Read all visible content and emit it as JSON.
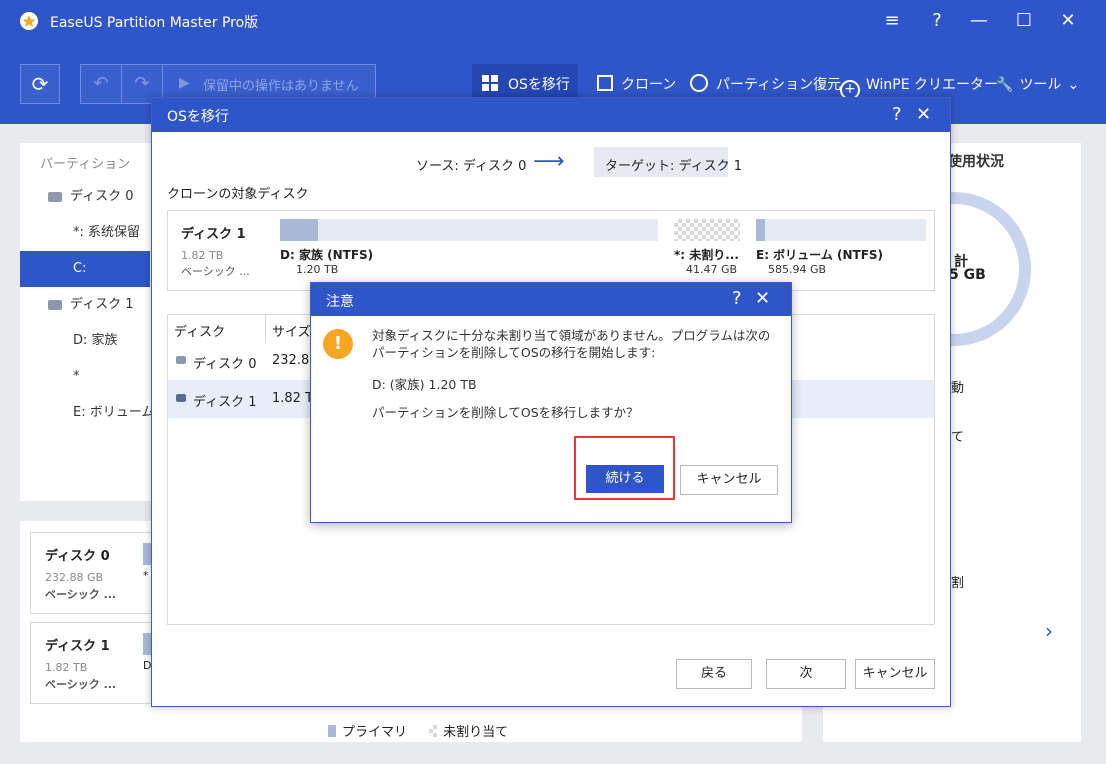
{
  "app": {
    "title": "EaseUS Partition Master Pro版"
  },
  "toolbar": {
    "pending": "保留中の操作はありません",
    "migrate_os": "OSを移行",
    "clone": "クローン",
    "recovery": "パーティション復元",
    "winpe": "WinPE クリエーター",
    "tools": "ツール"
  },
  "left_nav": {
    "header": "パーティション",
    "items": [
      {
        "label": "ディスク 0",
        "type": "disk"
      },
      {
        "label": "*: 系统保留",
        "type": "part"
      },
      {
        "label": "C:",
        "type": "part",
        "selected": true
      },
      {
        "label": "ディスク 1",
        "type": "disk"
      },
      {
        "label": "D: 家族",
        "type": "part"
      },
      {
        "label": "*",
        "type": "part"
      },
      {
        "label": "E: ボリューム",
        "type": "part"
      }
    ]
  },
  "bottom_disks": [
    {
      "name": "ディスク 0",
      "size": "232.88 GB",
      "kind": "ベーシック ...",
      "next_letter": "*"
    },
    {
      "name": "ディスク 1",
      "size": "1.82 TB",
      "kind": "ベーシック ...",
      "next_letter": "D"
    }
  ],
  "legend": {
    "primary": "プライマリ",
    "unallocated": "未割り当て"
  },
  "right_panel": {
    "header": "使用状況",
    "total_frag_1": "計",
    "total_frag_2": "5 GB",
    "op_1": "動",
    "op_2": "て",
    "op_3": "割"
  },
  "migrate_dialog": {
    "title": "OSを移行",
    "source": "ソース: ディスク 0",
    "arrow": "⟶",
    "target": "ターゲット: ディスク 1",
    "section_label": "クローンの対象ディスク",
    "disk": {
      "name": "ディスク 1",
      "size": "1.82 TB",
      "kind": "ベーシック ..."
    },
    "partitions": [
      {
        "name": "D: 家族 (NTFS)",
        "size": "1.20 TB",
        "used_fraction": 0.1
      },
      {
        "name": "*: 未割り...",
        "size": "41.47 GB",
        "used_fraction": 0
      },
      {
        "name": "E: ボリューム (NTFS)",
        "size": "585.94 GB",
        "used_fraction": 0.05
      }
    ],
    "table": {
      "columns": [
        "ディスク",
        "サイズ"
      ],
      "rows": [
        {
          "disk": "ディスク 0",
          "size": "232.88"
        },
        {
          "disk": "ディスク 1",
          "size": "1.82 TB"
        }
      ]
    },
    "buttons": {
      "back": "戻る",
      "next": "次",
      "cancel": "キャンセル"
    }
  },
  "warning": {
    "title": "注意",
    "message": "対象ディスクに十分な未割り当て領域がありません。プログラムは次のパーティションを削除してOSの移行を開始します:",
    "partition": "D: (家族) 1.20 TB",
    "question": "パーティションを削除してOSを移行しますか？",
    "continue": "続ける",
    "cancel": "キャンセル",
    "icon_glyph": "!"
  },
  "colors": {
    "brand": "#2f56c9",
    "highlight": "#e53935",
    "warning": "#f5a623",
    "selected": "#2f56c9"
  }
}
